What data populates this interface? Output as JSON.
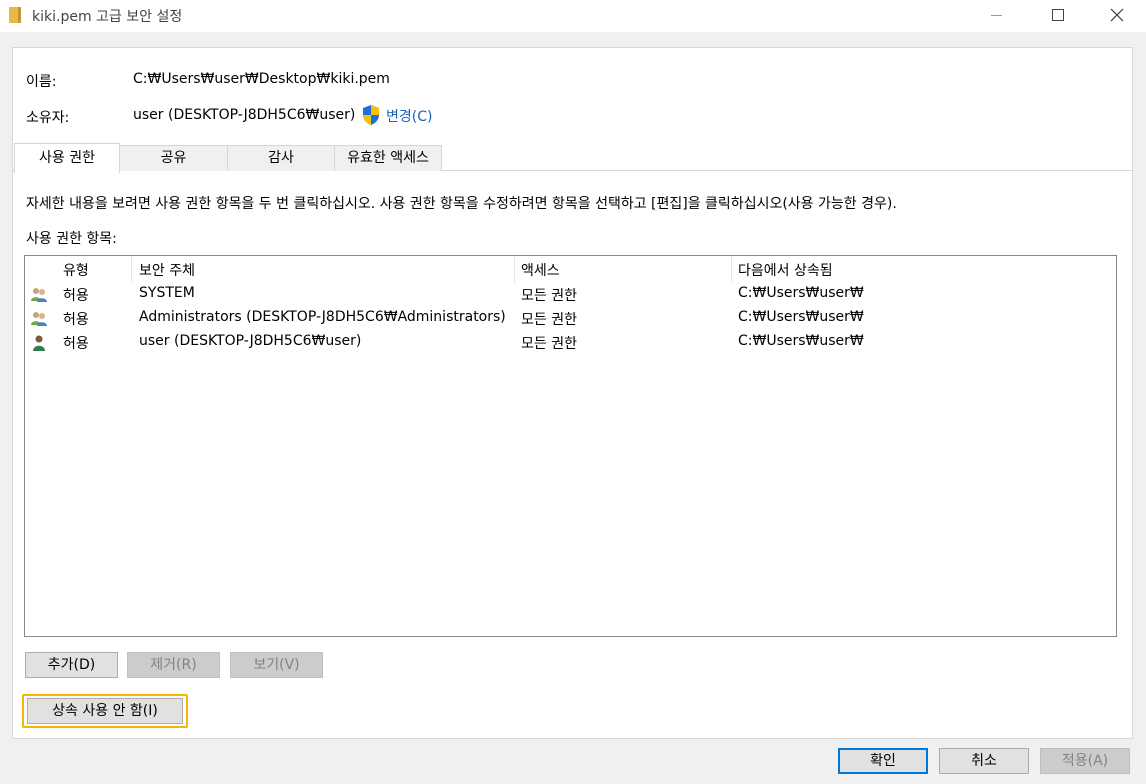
{
  "window": {
    "title": "kiki.pem 고급 보안 설정"
  },
  "info": {
    "name_label": "이름:",
    "name_value": "C:₩Users₩user₩Desktop₩kiki.pem",
    "owner_label": "소유자:",
    "owner_value": "user (DESKTOP-J8DH5C6₩user)",
    "change_link": "변경(C)"
  },
  "tabs": [
    {
      "label": "사용 권한",
      "active": true
    },
    {
      "label": "공유",
      "active": false
    },
    {
      "label": "감사",
      "active": false
    },
    {
      "label": "유효한 액세스",
      "active": false
    }
  ],
  "description": "자세한 내용을 보려면 사용 권한 항목을 두 번 클릭하십시오. 사용 권한 항목을 수정하려면 항목을 선택하고 [편집]을 클릭하십시오(사용 가능한 경우).",
  "entries_label": "사용 권한 항목:",
  "table": {
    "columns": [
      "유형",
      "보안 주체",
      "액세스",
      "다음에서 상속됨"
    ],
    "rows": [
      {
        "icon": "group-icon",
        "type": "허용",
        "principal": "SYSTEM",
        "access": "모든 권한",
        "inherited": "C:₩Users₩user₩"
      },
      {
        "icon": "group-icon",
        "type": "허용",
        "principal": "Administrators (DESKTOP-J8DH5C6₩Administrators)",
        "access": "모든 권한",
        "inherited": "C:₩Users₩user₩"
      },
      {
        "icon": "user-icon",
        "type": "허용",
        "principal": "user (DESKTOP-J8DH5C6₩user)",
        "access": "모든 권한",
        "inherited": "C:₩Users₩user₩"
      }
    ]
  },
  "buttons": {
    "add": "추가(D)",
    "remove": "제거(R)",
    "view": "보기(V)",
    "disable_inheritance": "상속 사용 안 함(I)",
    "ok": "확인",
    "cancel": "취소",
    "apply": "적용(A)"
  },
  "colors": {
    "link": "#1a65b8",
    "focus_highlight": "#f5b800",
    "default_button_border": "#0078d7"
  }
}
